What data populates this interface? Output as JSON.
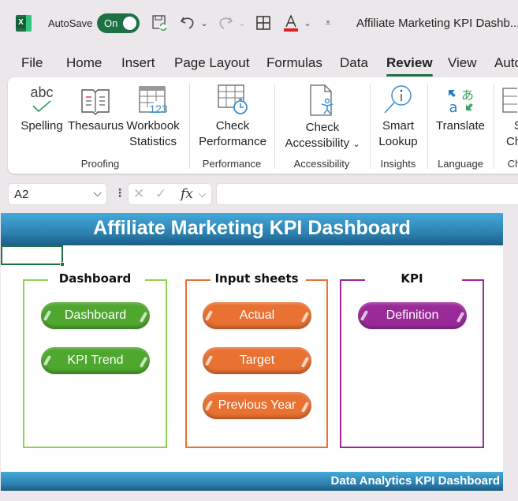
{
  "titlebar": {
    "autosave_label": "AutoSave",
    "autosave_state": "On",
    "document_title": "Affiliate Marketing KPI Dashb...",
    "quick_access_icons": [
      "save-sync-icon",
      "undo-icon",
      "redo-icon",
      "borders-icon",
      "font-color-icon",
      "customize-icon"
    ]
  },
  "tabs": [
    {
      "label": "File"
    },
    {
      "label": "Home"
    },
    {
      "label": "Insert"
    },
    {
      "label": "Page Layout"
    },
    {
      "label": "Formulas"
    },
    {
      "label": "Data"
    },
    {
      "label": "Review",
      "active": true
    },
    {
      "label": "View"
    },
    {
      "label": "Auto"
    }
  ],
  "ribbon": {
    "buttons": {
      "spelling": "Spelling",
      "thesaurus": "Thesaurus",
      "workbook_statistics_1": "Workbook",
      "workbook_statistics_2": "Statistics",
      "check_performance_1": "Check",
      "check_performance_2": "Performance",
      "check_accessibility_1": "Check",
      "check_accessibility_2": "Accessibility",
      "smart_lookup_1": "Smart",
      "smart_lookup_2": "Lookup",
      "translate": "Translate",
      "partial_1": "S",
      "partial_2": "Ch"
    },
    "groups": {
      "proofing": "Proofing",
      "performance": "Performance",
      "accessibility": "Accessibility",
      "insights": "Insights",
      "language": "Language",
      "partial": "Ch"
    },
    "icons": {
      "abc": "abc",
      "stats": "123"
    }
  },
  "formula_bar": {
    "name_box": "A2",
    "fx_label": "fx",
    "formula_value": ""
  },
  "sheet": {
    "title": "Affiliate Marketing KPI Dashboard",
    "footer": "Data Analytics KPI Dashboard",
    "panels": [
      {
        "title": "Dashboard",
        "color": "#92d050",
        "buttons": [
          "Dashboard",
          "KPI Trend"
        ]
      },
      {
        "title": "Input sheets",
        "color": "#e97132",
        "buttons": [
          "Actual",
          "Target",
          "Previous Year"
        ]
      },
      {
        "title": "KPI",
        "color": "#9b2a99",
        "buttons": [
          "Definition"
        ]
      }
    ]
  },
  "colors": {
    "excel_green": "#1e7145",
    "banner_blue": "#2e82b2",
    "button_green": "#4ea72e",
    "button_orange": "#e97132",
    "button_purple": "#9b2a99"
  }
}
